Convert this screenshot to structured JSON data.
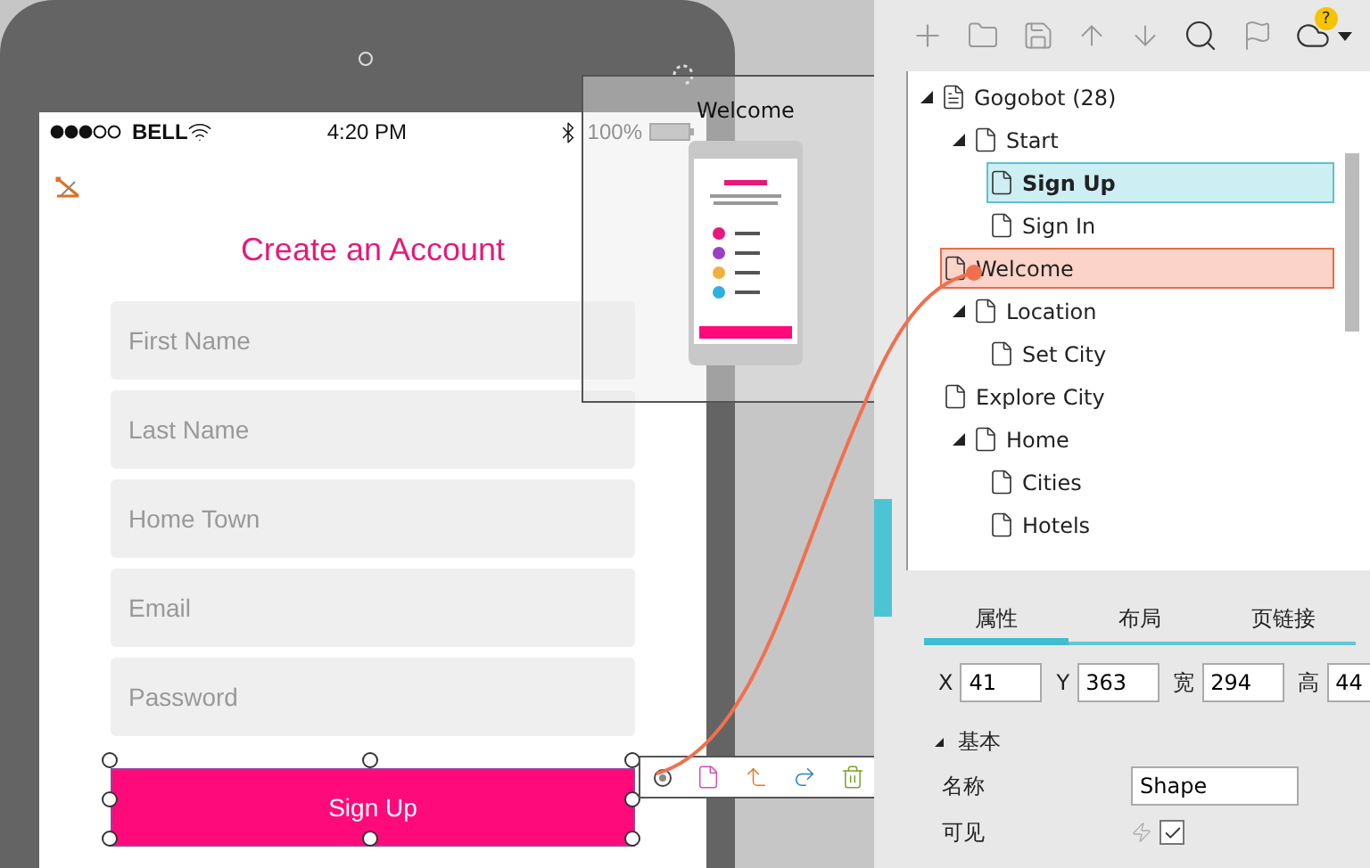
{
  "device": {
    "status_bar": {
      "carrier": "BELL",
      "time": "4:20 PM",
      "battery": "100%"
    },
    "screen": {
      "title": "Create an Account",
      "fields": [
        {
          "placeholder": "First Name"
        },
        {
          "placeholder": "Last Name"
        },
        {
          "placeholder": "Home Town"
        },
        {
          "placeholder": "Email"
        },
        {
          "placeholder": "Password"
        }
      ],
      "button": {
        "label": "Sign Up",
        "selected": true
      }
    }
  },
  "link_preview": {
    "title": "Welcome"
  },
  "toolbar": {
    "help_badge": "?"
  },
  "tree": [
    {
      "label": "Gogobot (28)",
      "kind": "project",
      "expanded": true,
      "selected": false,
      "link_target": false,
      "children": [
        {
          "label": "Start",
          "kind": "page",
          "expanded": true,
          "selected": false,
          "link_target": false,
          "children": [
            {
              "label": "Sign Up",
              "kind": "page",
              "selected": true,
              "link_target": false
            },
            {
              "label": "Sign In",
              "kind": "page",
              "selected": false,
              "link_target": false
            }
          ]
        },
        {
          "label": "Welcome",
          "kind": "page",
          "selected": false,
          "link_target": true
        },
        {
          "label": "Location",
          "kind": "page",
          "expanded": true,
          "selected": false,
          "link_target": false,
          "children": [
            {
              "label": "Set City",
              "kind": "page",
              "selected": false,
              "link_target": false
            }
          ]
        },
        {
          "label": "Explore City",
          "kind": "page",
          "selected": false,
          "link_target": false
        },
        {
          "label": "Home",
          "kind": "page",
          "expanded": true,
          "selected": false,
          "link_target": false,
          "children": [
            {
              "label": "Cities",
              "kind": "page",
              "selected": false,
              "link_target": false
            },
            {
              "label": "Hotels",
              "kind": "page",
              "selected": false,
              "link_target": false
            }
          ]
        }
      ]
    }
  ],
  "inspector": {
    "tabs": [
      {
        "label": "属性",
        "selected": true
      },
      {
        "label": "布局",
        "selected": false
      },
      {
        "label": "页链接",
        "selected": false
      }
    ],
    "geometry": [
      {
        "label": "X",
        "value": "41"
      },
      {
        "label": "Y",
        "value": "363"
      },
      {
        "label": "宽",
        "value": "294"
      },
      {
        "label": "高",
        "value": "44"
      }
    ],
    "section": {
      "title": "基本",
      "expanded": true
    },
    "properties": [
      {
        "kind": "text",
        "label": "名称",
        "value": "Shape"
      },
      {
        "kind": "checkbox",
        "label": "可见",
        "checked": true
      }
    ]
  }
}
